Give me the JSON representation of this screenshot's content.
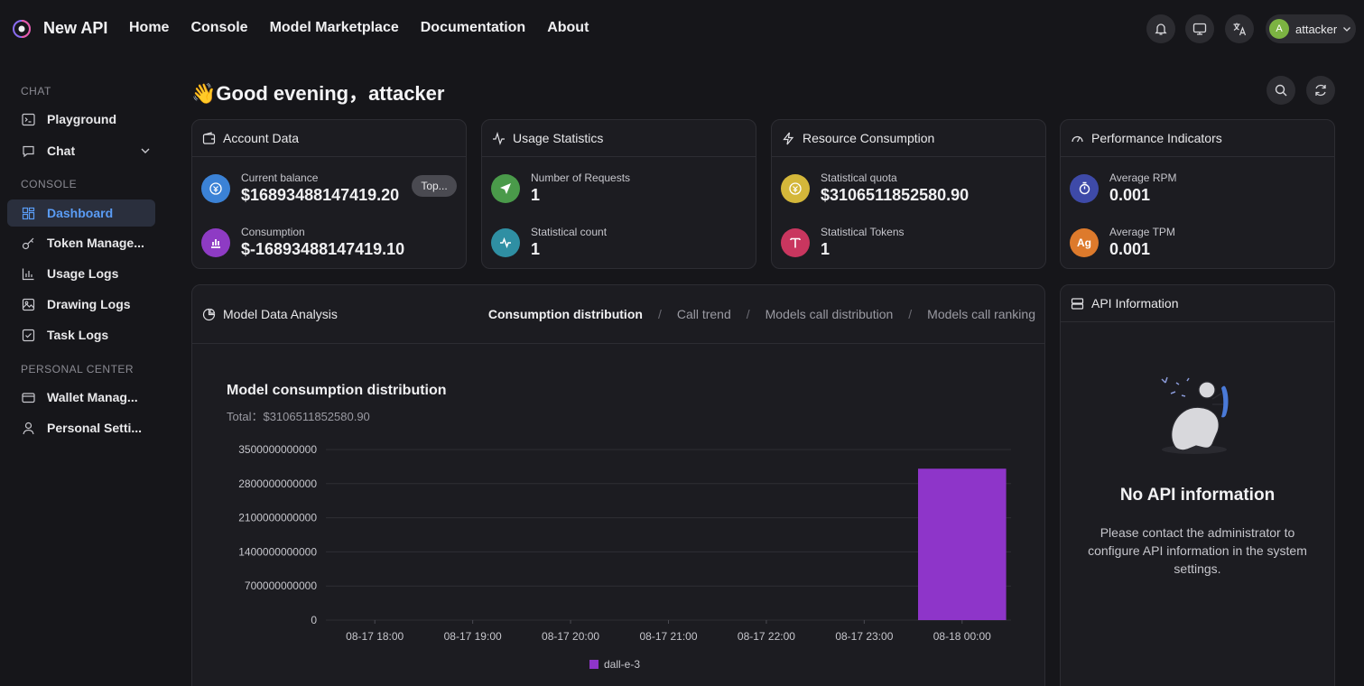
{
  "header": {
    "brand": "New API",
    "nav": [
      "Home",
      "Console",
      "Model Marketplace",
      "Documentation",
      "About"
    ],
    "user": {
      "initial": "A",
      "name": "attacker"
    }
  },
  "sidebar": {
    "sections": [
      {
        "title": "CHAT",
        "items": [
          {
            "label": "Playground",
            "icon": "terminal-icon"
          },
          {
            "label": "Chat",
            "icon": "chat-bubble-icon",
            "expandable": true
          }
        ]
      },
      {
        "title": "CONSOLE",
        "items": [
          {
            "label": "Dashboard",
            "icon": "dashboard-grid-icon",
            "active": true
          },
          {
            "label": "Token Manage...",
            "icon": "key-icon"
          },
          {
            "label": "Usage Logs",
            "icon": "bar-chart-icon"
          },
          {
            "label": "Drawing Logs",
            "icon": "image-icon"
          },
          {
            "label": "Task Logs",
            "icon": "checkbox-icon"
          }
        ]
      },
      {
        "title": "PERSONAL CENTER",
        "items": [
          {
            "label": "Wallet Manag...",
            "icon": "credit-card-icon"
          },
          {
            "label": "Personal Setti...",
            "icon": "user-icon"
          }
        ]
      }
    ]
  },
  "greeting": "👋Good evening，attacker",
  "cards": {
    "account": {
      "title": "Account Data",
      "items": [
        {
          "label": "Current balance",
          "value": "$16893488147419.20",
          "color": "#3b82d6"
        },
        {
          "label": "Consumption",
          "value": "$-16893488147419.10",
          "color": "#8e3bc4"
        }
      ],
      "topup_label": "Top..."
    },
    "usage": {
      "title": "Usage Statistics",
      "items": [
        {
          "label": "Number of Requests",
          "value": "1",
          "color": "#4a9a4a"
        },
        {
          "label": "Statistical count",
          "value": "1",
          "color": "#2f8fa3"
        }
      ]
    },
    "resource": {
      "title": "Resource Consumption",
      "items": [
        {
          "label": "Statistical quota",
          "value": "$3106511852580.90",
          "color": "#d4b73a"
        },
        {
          "label": "Statistical Tokens",
          "value": "1",
          "color": "#c9365f"
        }
      ]
    },
    "performance": {
      "title": "Performance Indicators",
      "items": [
        {
          "label": "Average RPM",
          "value": "0.001",
          "color": "#3e4aa8"
        },
        {
          "label": "Average TPM",
          "value": "0.001",
          "color": "#dd7a2c",
          "badge": "Ag"
        }
      ]
    }
  },
  "analysis": {
    "title": "Model Data Analysis",
    "tabs": [
      "Consumption distribution",
      "Call trend",
      "Models call distribution",
      "Models call ranking"
    ],
    "active_tab": 0
  },
  "chart_data": {
    "type": "bar",
    "title": "Model consumption distribution",
    "subtitle": "Total：$3106511852580.90",
    "categories": [
      "08-17 18:00",
      "08-17 19:00",
      "08-17 20:00",
      "08-17 21:00",
      "08-17 22:00",
      "08-17 23:00",
      "08-18 00:00"
    ],
    "series": [
      {
        "name": "dall-e-3",
        "values": [
          0,
          0,
          0,
          0,
          0,
          0,
          3106511852580.9
        ],
        "color": "#8e35c9"
      }
    ],
    "ylim": [
      0,
      3500000000000
    ],
    "yticks": [
      "0",
      "700000000000",
      "1400000000000",
      "2100000000000",
      "2800000000000",
      "3500000000000"
    ],
    "legend": "bottom-center",
    "grid": true
  },
  "api_info": {
    "title": "API Information",
    "empty_title": "No API information",
    "empty_desc": "Please contact the administrator to configure API information in the system settings."
  }
}
